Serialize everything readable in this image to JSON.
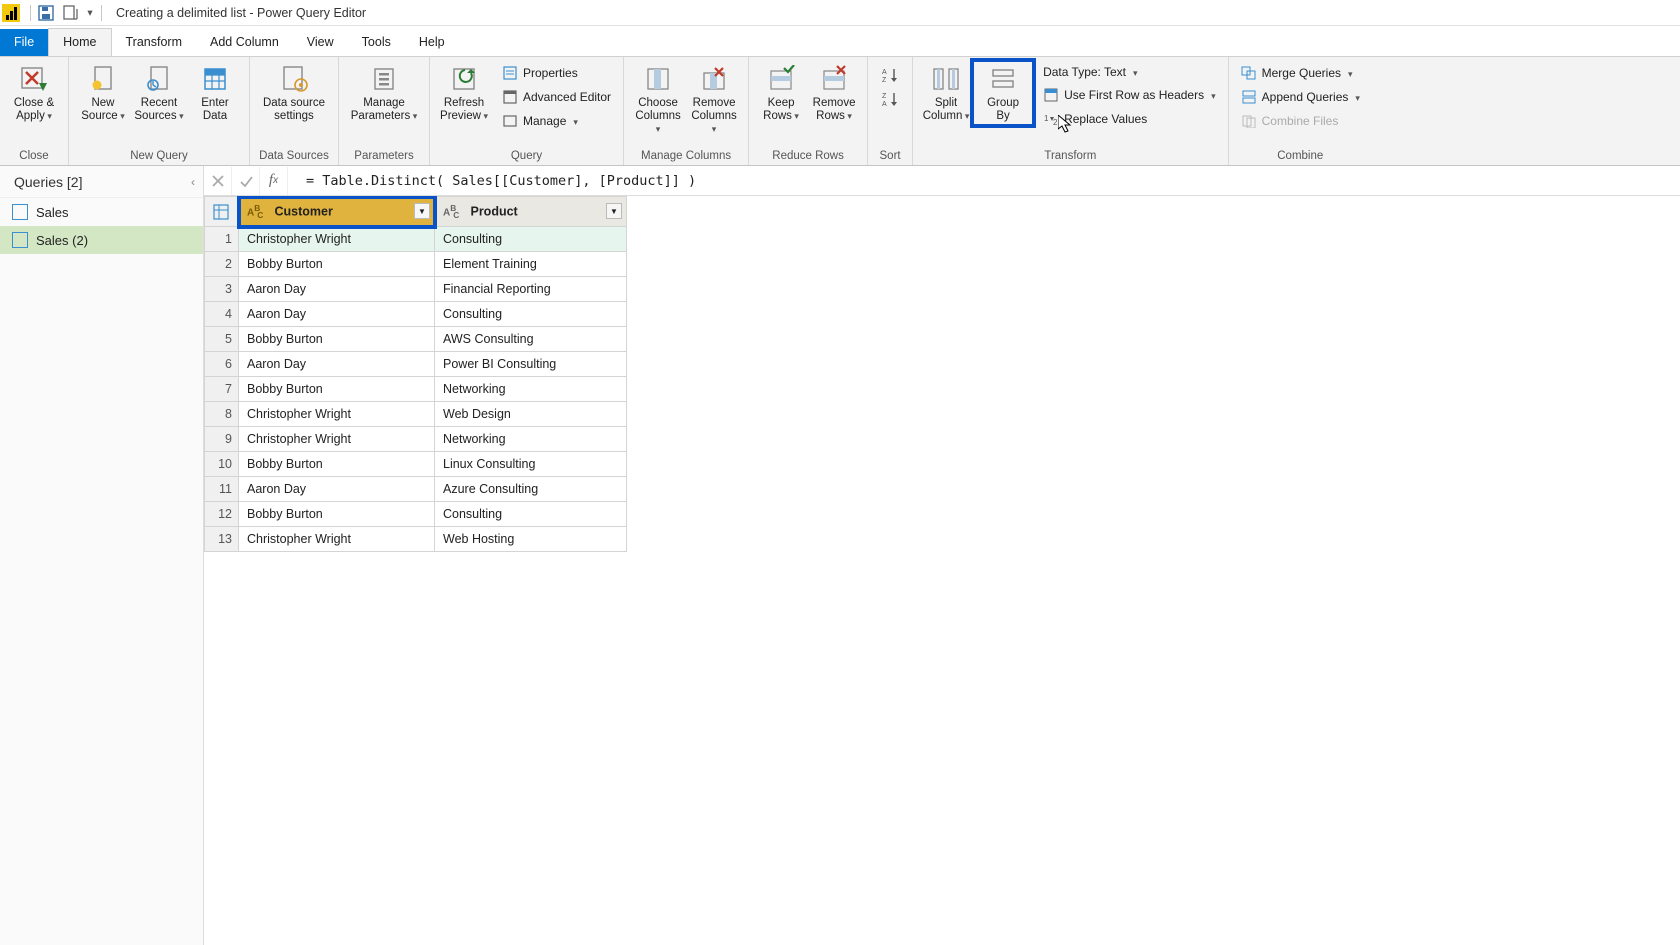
{
  "title": "Creating a delimited list - Power Query Editor",
  "tabs": {
    "file": "File",
    "home": "Home",
    "transform": "Transform",
    "addColumn": "Add Column",
    "view": "View",
    "tools": "Tools",
    "help": "Help"
  },
  "groups": {
    "close": "Close",
    "newQuery": "New Query",
    "dataSources": "Data Sources",
    "parameters": "Parameters",
    "query": "Query",
    "manageColumns": "Manage Columns",
    "reduceRows": "Reduce Rows",
    "sort": "Sort",
    "transform": "Transform",
    "combine": "Combine"
  },
  "btns": {
    "closeApply": "Close &\nApply",
    "newSource": "New\nSource",
    "recentSources": "Recent\nSources",
    "enterData": "Enter\nData",
    "dataSourceSettings": "Data source\nsettings",
    "manageParameters": "Manage\nParameters",
    "refreshPreview": "Refresh\nPreview",
    "properties": "Properties",
    "advancedEditor": "Advanced Editor",
    "manage": "Manage",
    "chooseColumns": "Choose\nColumns",
    "removeColumns": "Remove\nColumns",
    "keepRows": "Keep\nRows",
    "removeRows": "Remove\nRows",
    "splitColumn": "Split\nColumn",
    "groupBy": "Group\nBy",
    "dataType": "Data Type: Text",
    "firstRowHeaders": "Use First Row as Headers",
    "replaceValues": "Replace Values",
    "mergeQueries": "Merge Queries",
    "appendQueries": "Append Queries",
    "combineFiles": "Combine Files"
  },
  "queries": {
    "header": "Queries [2]",
    "items": [
      {
        "label": "Sales"
      },
      {
        "label": "Sales (2)"
      }
    ]
  },
  "formula": "= Table.Distinct( Sales[[Customer], [Product]] )",
  "columns": {
    "customer": "Customer",
    "product": "Product"
  },
  "rows": [
    {
      "c": "Christopher Wright",
      "p": "Consulting"
    },
    {
      "c": "Bobby Burton",
      "p": "Element Training"
    },
    {
      "c": "Aaron Day",
      "p": "Financial Reporting"
    },
    {
      "c": "Aaron Day",
      "p": "Consulting"
    },
    {
      "c": "Bobby Burton",
      "p": "AWS Consulting"
    },
    {
      "c": "Aaron Day",
      "p": "Power BI Consulting"
    },
    {
      "c": "Bobby Burton",
      "p": "Networking"
    },
    {
      "c": "Christopher Wright",
      "p": "Web Design"
    },
    {
      "c": "Christopher Wright",
      "p": "Networking"
    },
    {
      "c": "Bobby Burton",
      "p": "Linux Consulting"
    },
    {
      "c": "Aaron Day",
      "p": "Azure Consulting"
    },
    {
      "c": "Bobby Burton",
      "p": "Consulting"
    },
    {
      "c": "Christopher Wright",
      "p": "Web Hosting"
    }
  ]
}
